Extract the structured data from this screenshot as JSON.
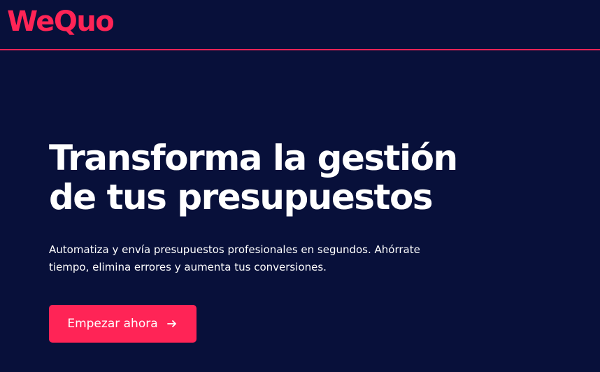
{
  "app": {
    "logo": "WeQuo"
  },
  "hero": {
    "title_line_1": "Transforma la gestión",
    "title_line_2": "de tus presupuestos",
    "subtitle_line_1": "Automatiza y envía presupuestos profesionales en segundos. Ahórrate",
    "subtitle_line_2": "tiempo, elimina errores y aumenta tus conversiones.",
    "cta_label": "Empezar ahora",
    "cta_icon": "arrow-right-icon"
  },
  "colors": {
    "background": "#08103a",
    "accent": "#ff2456",
    "text": "#ffffff"
  }
}
